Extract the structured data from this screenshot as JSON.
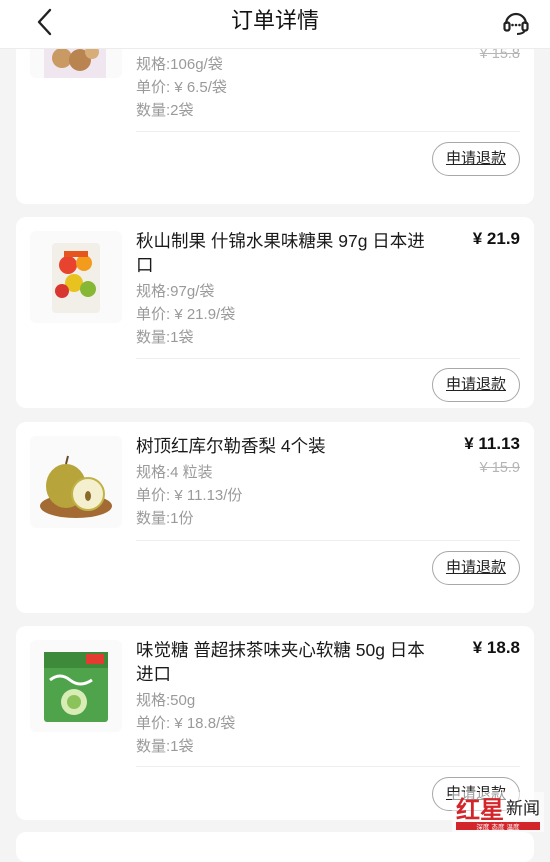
{
  "header": {
    "title": "订单详情",
    "back_icon": "chevron-left-icon",
    "support_icon": "headset-icon"
  },
  "items": [
    {
      "name": "",
      "price": "",
      "original_price": "¥ 15.8",
      "spec": "规格:106g/袋",
      "unit_price": "单价: ¥ 6.5/袋",
      "quantity": "数量:2袋",
      "refund_label": "申请退款"
    },
    {
      "name": "秋山制果 什锦水果味糖果 97g 日本进口",
      "price": "¥ 21.9",
      "original_price": "",
      "spec": "规格:97g/袋",
      "unit_price": "单价: ¥ 21.9/袋",
      "quantity": "数量:1袋",
      "refund_label": "申请退款"
    },
    {
      "name": "树顶红库尔勒香梨 4个装",
      "price": "¥ 11.13",
      "original_price": "¥ 15.9",
      "spec": "规格:4 粒装",
      "unit_price": "单价: ¥ 11.13/份",
      "quantity": "数量:1份",
      "refund_label": "申请退款"
    },
    {
      "name": "味觉糖 普超抹茶味夹心软糖 50g 日本进口",
      "price": "¥ 18.8",
      "original_price": "",
      "spec": "规格:50g",
      "unit_price": "单价: ¥ 18.8/袋",
      "quantity": "数量:1袋",
      "refund_label": "申请退款"
    }
  ],
  "watermark": {
    "main": "红星新闻",
    "sub": "深度 态度 温度",
    "colors": {
      "red": "#d3262b"
    }
  }
}
